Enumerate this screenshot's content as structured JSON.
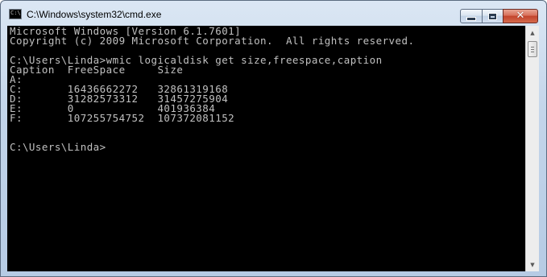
{
  "window": {
    "title": "C:\\Windows\\system32\\cmd.exe",
    "icon": "cmd-console-icon",
    "icon_text": "C:\\"
  },
  "caption_buttons": {
    "minimize_icon": "minimize-icon",
    "maximize_icon": "maximize-icon",
    "close_icon": "close-icon",
    "close_glyph": "✕"
  },
  "console": {
    "text_color": "#c0c0c0",
    "background": "#000000",
    "lines": [
      "Microsoft Windows [Version 6.1.7601]",
      "Copyright (c) 2009 Microsoft Corporation.  All rights reserved.",
      "",
      "C:\\Users\\Linda>wmic logicaldisk get size,freespace,caption",
      "Caption  FreeSpace     Size",
      "A:",
      "C:       16436662272   32861319168",
      "D:       31282573312   31457275904",
      "E:       0             401936384",
      "F:       107255754752  107372081152",
      "",
      "",
      "C:\\Users\\Linda>"
    ]
  },
  "scrollbar": {
    "up_glyph": "▲",
    "down_glyph": "▼"
  }
}
